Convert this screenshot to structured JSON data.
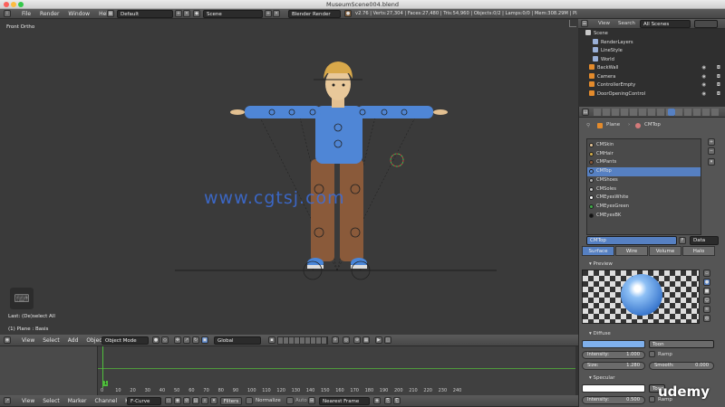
{
  "window": {
    "title": "MuseumScene004.blend"
  },
  "info_header": {
    "menus": [
      "File",
      "Render",
      "Window",
      "Help"
    ],
    "layout": "Default",
    "scene": "Scene",
    "engine": "Blender Render",
    "stats": "v2.76 | Verts:27,304 | Faces:27,480 | Tris:54,960 | Objects:0/2 | Lamps:0/0 | Mem:308.29M | Plane"
  },
  "viewport": {
    "view_label": "Front Ortho",
    "object_label": "(1) Plane : Basis",
    "last_op": "Last: (De)select All",
    "watermark": "www.cgtsj.com",
    "menus": [
      "View",
      "Select",
      "Add",
      "Object"
    ],
    "mode": "Object Mode",
    "orientation": "Global"
  },
  "outliner": {
    "menus": [
      "View",
      "Search"
    ],
    "filter": "All Scenes",
    "items": [
      "Scene",
      "RenderLayers",
      "LineStyle",
      "World",
      "BackWall",
      "Camera",
      "ControllerEmpty",
      "DoorOpeningControl"
    ]
  },
  "properties": {
    "breadcrumb": [
      "Plane",
      "CMTop"
    ],
    "materials": [
      {
        "name": "CMSkin",
        "color": "#e8c89a"
      },
      {
        "name": "CMHair",
        "color": "#d7b04b"
      },
      {
        "name": "CMPants",
        "color": "#8a5a3a"
      },
      {
        "name": "CMTop",
        "color": "#5b8fd9"
      },
      {
        "name": "CMShoes",
        "color": "#b0b0b0"
      },
      {
        "name": "CMSoles",
        "color": "#d0d0d0"
      },
      {
        "name": "CMEyesWhite",
        "color": "#ffffff"
      },
      {
        "name": "CMEyesGreen",
        "color": "#3fae49"
      },
      {
        "name": "CMEyesBK",
        "color": "#111111"
      }
    ],
    "selected_material": "CMTop",
    "slot_mode": "Data",
    "tabs": [
      "Surface",
      "Wire",
      "Volume",
      "Halo"
    ],
    "preview_label": "Preview",
    "diffuse": {
      "label": "Diffuse",
      "shader": "Toon",
      "intensity_label": "Intensity:",
      "intensity": "1.000",
      "ramp_label": "Ramp",
      "size_label": "Size:",
      "size": "1.280",
      "smooth_label": "Smooth:",
      "smooth": "0.000",
      "color": "#7fb0ec"
    },
    "specular": {
      "label": "Specular",
      "intensity_label": "Intensity:",
      "intensity": "0.500",
      "shader_short": "Toon",
      "ramp_label": "Ramp"
    }
  },
  "timeline": {
    "menus": [
      "View",
      "Select",
      "Marker",
      "Channel",
      "Key"
    ],
    "editor": "F-Curve",
    "filters_label": "Filters",
    "normalize_label": "Normalize",
    "auto_label": "Auto",
    "snap": "Nearest Frame",
    "current_frame": "1",
    "ticks": [
      "0",
      "10",
      "20",
      "30",
      "40",
      "50",
      "60",
      "70",
      "80",
      "90",
      "100",
      "110",
      "120",
      "130",
      "140",
      "150",
      "160",
      "170",
      "180",
      "190",
      "200",
      "210",
      "220",
      "230",
      "240"
    ]
  },
  "brand": {
    "logo": "udemy"
  }
}
